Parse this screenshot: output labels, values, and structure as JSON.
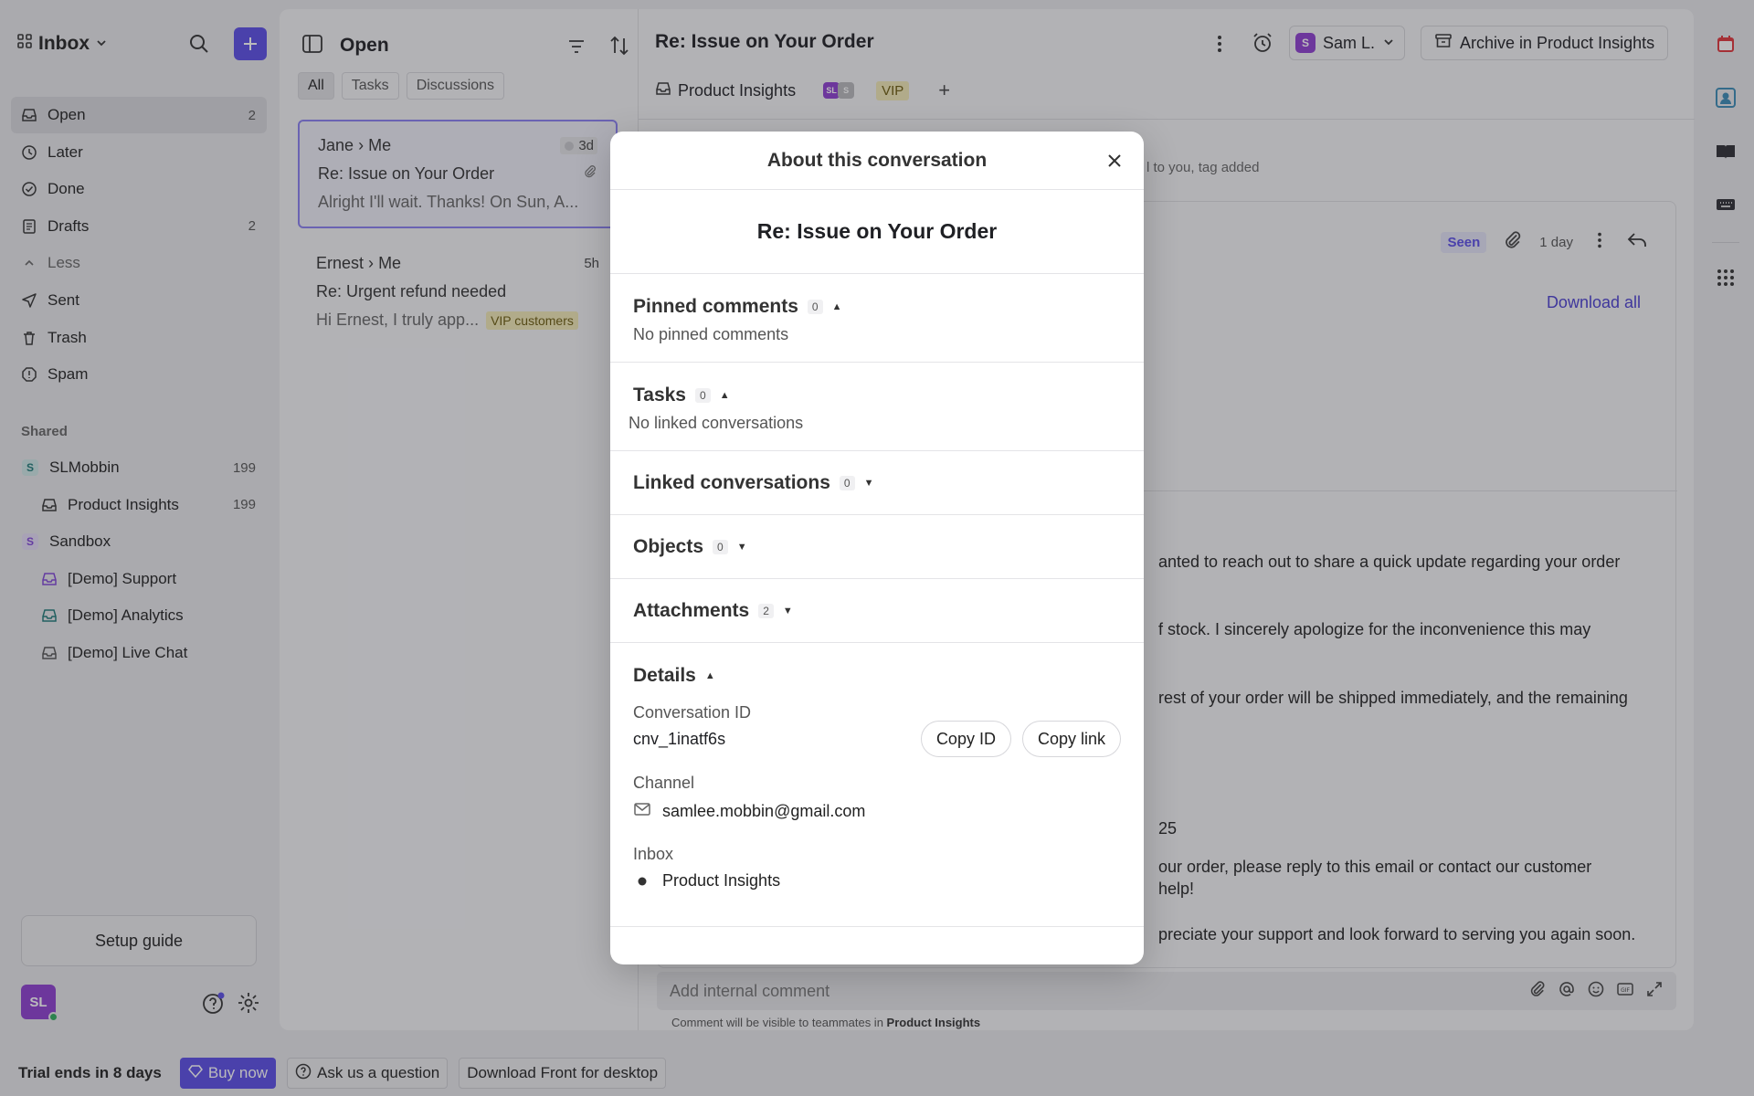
{
  "sidebar": {
    "inbox_label": "Inbox",
    "nav": [
      {
        "label": "Open",
        "count": "2",
        "icon": "inbox-icon"
      },
      {
        "label": "Later",
        "count": "",
        "icon": "clock-icon"
      },
      {
        "label": "Done",
        "count": "",
        "icon": "check-circle-icon"
      },
      {
        "label": "Drafts",
        "count": "2",
        "icon": "draft-icon"
      },
      {
        "label": "Less",
        "count": "",
        "icon": "chevron-up-icon"
      },
      {
        "label": "Sent",
        "count": "",
        "icon": "send-icon"
      },
      {
        "label": "Trash",
        "count": "",
        "icon": "trash-icon"
      },
      {
        "label": "Spam",
        "count": "",
        "icon": "spam-icon"
      }
    ],
    "shared_heading": "Shared",
    "shared": [
      {
        "label": "SLMobbin",
        "count": "199",
        "badge": "S"
      },
      {
        "label": "Product Insights",
        "count": "199"
      },
      {
        "label": "Sandbox",
        "count": "",
        "badge": "S"
      },
      {
        "label": "[Demo] Support",
        "count": ""
      },
      {
        "label": "[Demo] Analytics",
        "count": ""
      },
      {
        "label": "[Demo] Live Chat",
        "count": ""
      }
    ],
    "setup_guide": "Setup guide",
    "avatar_initials": "SL"
  },
  "bottombar": {
    "trial": "Trial ends in 8 days",
    "buy_now": "Buy now",
    "ask": "Ask us a question",
    "download": "Download Front for desktop"
  },
  "list": {
    "title": "Open",
    "tabs": [
      "All",
      "Tasks",
      "Discussions"
    ],
    "conversations": [
      {
        "from": "Jane",
        "to": "Me",
        "time": "3d",
        "subject": "Re: Issue on Your Order",
        "preview": "Alright I'll wait. Thanks! On Sun, A...",
        "tag": ""
      },
      {
        "from": "Ernest",
        "to": "Me",
        "time": "5h",
        "subject": "Re: Urgent refund needed",
        "preview": "Hi Ernest, I truly app...",
        "tag": "VIP customers"
      }
    ]
  },
  "main": {
    "title": "Re: Issue on Your Order",
    "assignee": "Sam L.",
    "assignee_initial": "S",
    "archive": "Archive in Product Insights",
    "inbox": "Product Insights",
    "vip": "VIP",
    "activity": "l to you, tag added",
    "seen": "Seen",
    "age": "1 day",
    "download_all": "Download all",
    "body": [
      "anted to reach out to share a quick update regarding your order",
      "f stock. I sincerely apologize for the inconvenience this may",
      "rest of your order will be shipped immediately, and the remaining",
      "25",
      "our order, please reply to this email or contact our customer",
      "help!",
      "preciate your support and look forward to serving you again soon."
    ],
    "comment_placeholder": "Add internal comment",
    "comment_note_prefix": "Comment will be visible to teammates in",
    "comment_note_inbox": "Product Insights"
  },
  "modal": {
    "title": "About this conversation",
    "subject": "Re: Issue on Your Order",
    "pinned": {
      "label": "Pinned comments",
      "count": "0",
      "empty": "No pinned comments"
    },
    "tasks": {
      "label": "Tasks",
      "count": "0",
      "empty": "No linked conversations"
    },
    "linked": {
      "label": "Linked conversations",
      "count": "0"
    },
    "objects": {
      "label": "Objects",
      "count": "0"
    },
    "attachments": {
      "label": "Attachments",
      "count": "2"
    },
    "details": {
      "label": "Details",
      "conv_id_label": "Conversation ID",
      "conv_id": "cnv_1inatf6s",
      "copy_id": "Copy ID",
      "copy_link": "Copy link",
      "channel_label": "Channel",
      "channel": "samlee.mobbin@gmail.com",
      "inbox_label": "Inbox",
      "inbox": "Product Insights"
    }
  },
  "colors": {
    "accent": "#5a4de6",
    "vip_bg": "#f2e9b6",
    "overlay": "rgba(40,40,48,0.32)"
  }
}
